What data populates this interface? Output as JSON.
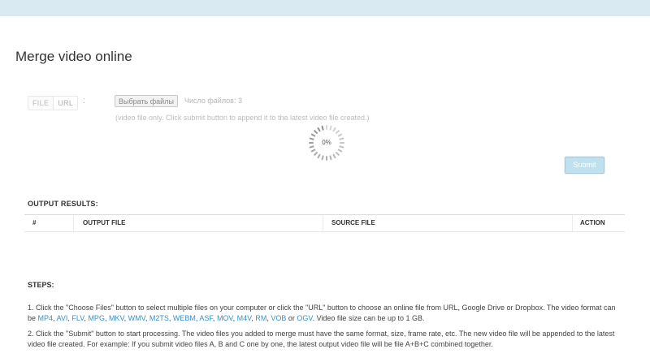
{
  "page": {
    "title": "Merge video online"
  },
  "form": {
    "tab_file": "FILE",
    "tab_url": "URL",
    "colon": ":",
    "choose_button": "Выбрать файлы",
    "file_count": "Число файлов: 3",
    "hint": "(video file only. Click submit button to append it to the latest video file created.)",
    "progress_text": "0%",
    "progress_percent": 0,
    "submit_label": "Submit"
  },
  "output": {
    "title": "OUTPUT RESULTS:",
    "columns": [
      "#",
      "OUTPUT FILE",
      "SOURCE FILE",
      "ACTION"
    ]
  },
  "steps": {
    "title": "STEPS:",
    "step1_before": "1. Click the \"Choose Files\" button to select multiple files on your computer or click the \"URL\" button to choose an online file from URL, Google Drive or Dropbox. The video format can be ",
    "formats": [
      "MP4",
      "AVI",
      "FLV",
      "MPG",
      "MKV",
      "WMV",
      "M2TS",
      "WEBM",
      "ASF",
      "MOV",
      "M4V",
      "RM",
      "VOB",
      "OGV"
    ],
    "or_word": " or ",
    "step1_after": ". Video file size can be up to 1 GB.",
    "step2": "2. Click the \"Submit\" button to start processing. The video files you added to merge must have the same format, size, frame rate, etc. The new video file will be appended to the latest video file created. For example: If you submit video files A, B and C one by one, the latest output video file will be file A+B+C combined together."
  },
  "colors": {
    "accent": "#3a8fc4",
    "topbar": "#d9eaf2",
    "submit": "#bfe0ee"
  }
}
